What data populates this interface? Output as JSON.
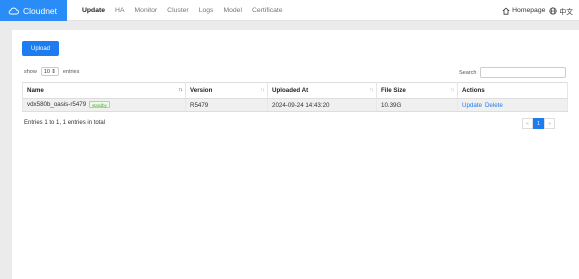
{
  "brand": {
    "name": "Cloudnet",
    "color": "#2a8cf7"
  },
  "nav": {
    "links": [
      {
        "label": "Update",
        "active": true
      },
      {
        "label": "HA",
        "active": false
      },
      {
        "label": "Monitor",
        "active": false
      },
      {
        "label": "Cluster",
        "active": false
      },
      {
        "label": "Logs",
        "active": false
      },
      {
        "label": "Model",
        "active": false
      },
      {
        "label": "Certificate",
        "active": false
      }
    ],
    "homepage_label": "Homepage",
    "language_label": "中文"
  },
  "toolbar": {
    "upload_label": "Upload"
  },
  "table_controls": {
    "show_label": "show",
    "page_size": "10",
    "entries_label": "entries",
    "search_label": "Search",
    "search_value": ""
  },
  "table": {
    "columns": [
      "Name",
      "Version",
      "Uploaded At",
      "File Size",
      "Actions"
    ],
    "rows": [
      {
        "name": "vdx580b_oasis-r5479",
        "badge": "standby",
        "version": "R5479",
        "uploaded_at": "2024-09-24 14:43:20",
        "file_size": "10.39G",
        "actions": [
          "Update",
          "Delete"
        ]
      }
    ]
  },
  "footer": {
    "info": "Entries 1 to 1, 1 entries in total",
    "prev": "«",
    "current_page": "1",
    "next": "»"
  }
}
